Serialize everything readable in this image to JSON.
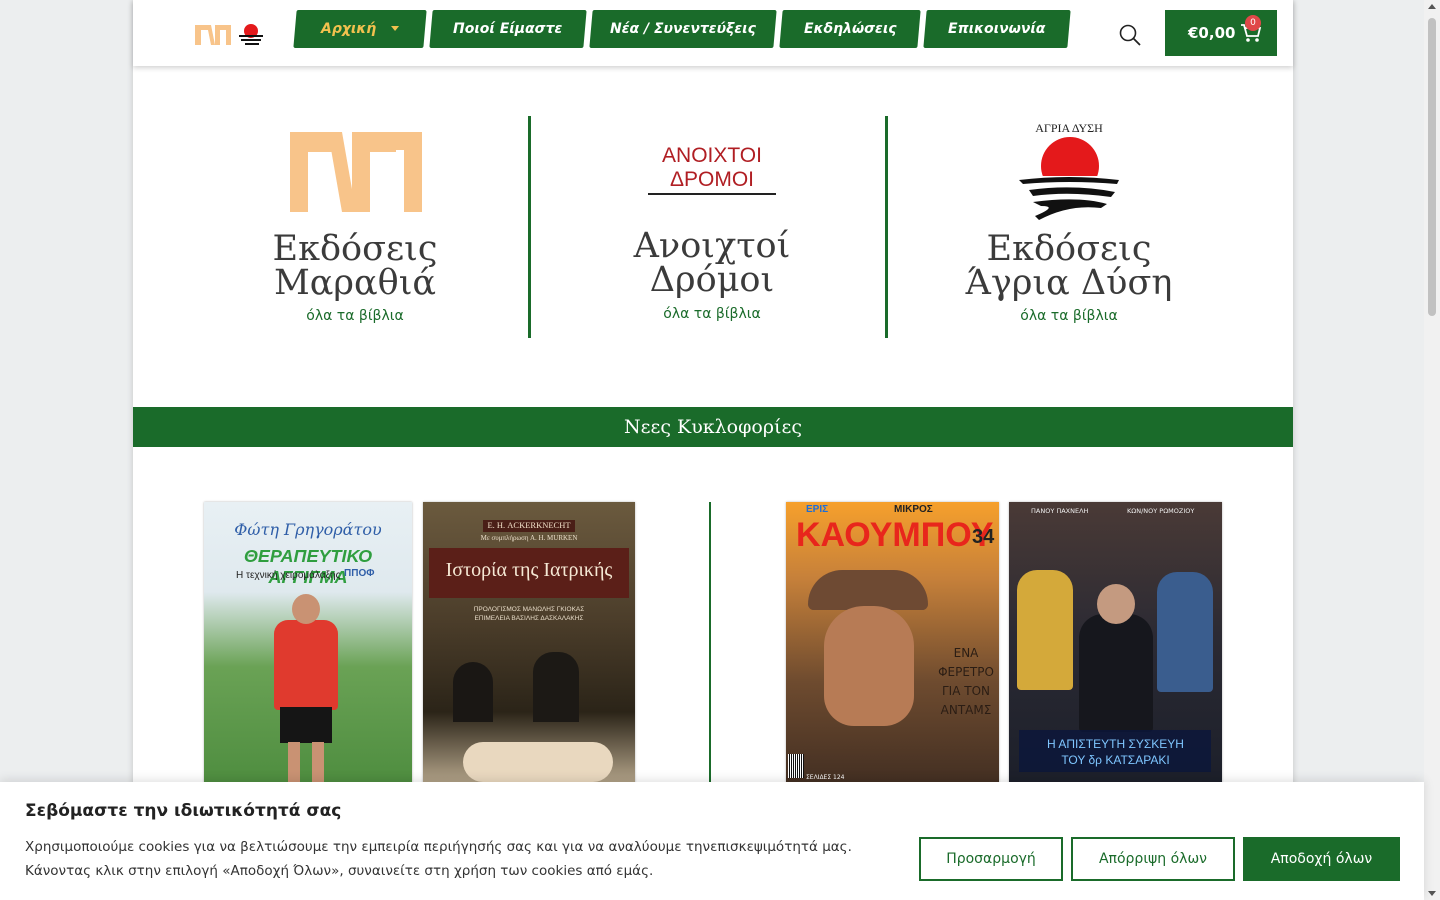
{
  "header": {
    "nav": [
      {
        "label": "Αρχική",
        "active": true,
        "has_dropdown": true
      },
      {
        "label": "Ποιοί Είμαστε",
        "active": false
      },
      {
        "label": "Νέα / Συνεντεύξεις",
        "active": false
      },
      {
        "label": "Εκδηλώσεις",
        "active": false
      },
      {
        "label": "Επικοινωνία",
        "active": false
      }
    ],
    "cart": {
      "total": "€0,00",
      "count": "0"
    }
  },
  "publishers": [
    {
      "logo_text": "",
      "title_line1": "Εκδόσεις",
      "title_line2": "Μαραθιά",
      "link": "όλα τα βίβλια"
    },
    {
      "logo_text_line1": "ΑΝΟΙΧΤΟΙ",
      "logo_text_line2": "ΔΡΟΜΟΙ",
      "title_line1": "Ανοιχτοί",
      "title_line2": "Δρόμοι",
      "link": "όλα τα βίβλια"
    },
    {
      "logo_text": "ΑΓΡΙΑ ΔΥΣΗ",
      "title_line1": "Εκδόσεις",
      "title_line2": "Άγρια Δύση",
      "link": "όλα τα βίβλια"
    }
  ],
  "section_title": "Νεες Κυκλοφορίες",
  "books": [
    {
      "author": "Φώτη Γρηγοράτου",
      "title": "ΘΕΡΑΠΕΥΤΙΚΟ ΑΓΓΙΓΜΑ",
      "subtitle": "Η τεχνική χειρομάλαξης",
      "badge": "ΠΠΟΦ"
    },
    {
      "author": "Ε. Η. ACKERKNECHT",
      "editor": "Με συμπλήρωση Α. Η. MURKEN",
      "title": "Ιστορία της Ιατρικής",
      "note1": "ΠΡΟΛΟΓΙΣΜΟΣ ΜΑΝΩΛΗΣ ΓΚΙΟΚΑΣ",
      "note2": "ΕΠΙΜΕΛΕΙΑ ΒΑΣΙΛΗΣ ΔΑΣΚΑΛΑΚΗΣ"
    },
    {
      "brand_small": "ΕΡΙΣ",
      "brand_top": "ΜΙΚΡΟΣ",
      "brand": "ΚΑΟΥΜΠΟΥ",
      "issue": "34",
      "tagline_l1": "ΕΝΑ",
      "tagline_l2": "ΦΕΡΕΤΡΟ",
      "tagline_l3": "ΓΙΑ ΤΟΝ",
      "tagline_l4": "ΑΝΤΑΜΣ",
      "pages": "ΣΕΛΙΔΕΣ 124"
    },
    {
      "author_left": "ΠΑΝΟΥ ΠΑΧΝΕΛΗ",
      "author_right": "ΚΩΝ/ΝΟΥ ΡΩΜΟΖΙΟΥ",
      "title_l1": "Η ΑΠΙΣΤΕΥΤΗ ΣΥΣΚΕΥΗ",
      "title_l2": "ΤΟΥ δρ ΚΑΤΣΑΡΑΚΙ"
    }
  ],
  "cookie": {
    "title": "Σεβόμαστε την ιδιωτικότητά σας",
    "text": "Χρησιμοποιούμε cookies για να βελτιώσουμε την εμπειρία περιήγησής σας και για  να αναλύουμε τηνεπισκεψιμότητά μας. Κάνοντας κλικ στην επιλογή «Αποδοχή Όλων», συναινείτε στη χρήση των cookies από εμάς.",
    "customize": "Προσαρμογή",
    "reject": "Απόρριψη όλων",
    "accept": "Αποδοχή όλων"
  },
  "colors": {
    "brand_green": "#1a6b2a",
    "nav_active": "#f2c14e",
    "logo_orange": "#f8c48a",
    "logo_red": "#e4191b"
  },
  "icons": [
    "search-icon",
    "cart-icon",
    "chevron-down-icon"
  ]
}
